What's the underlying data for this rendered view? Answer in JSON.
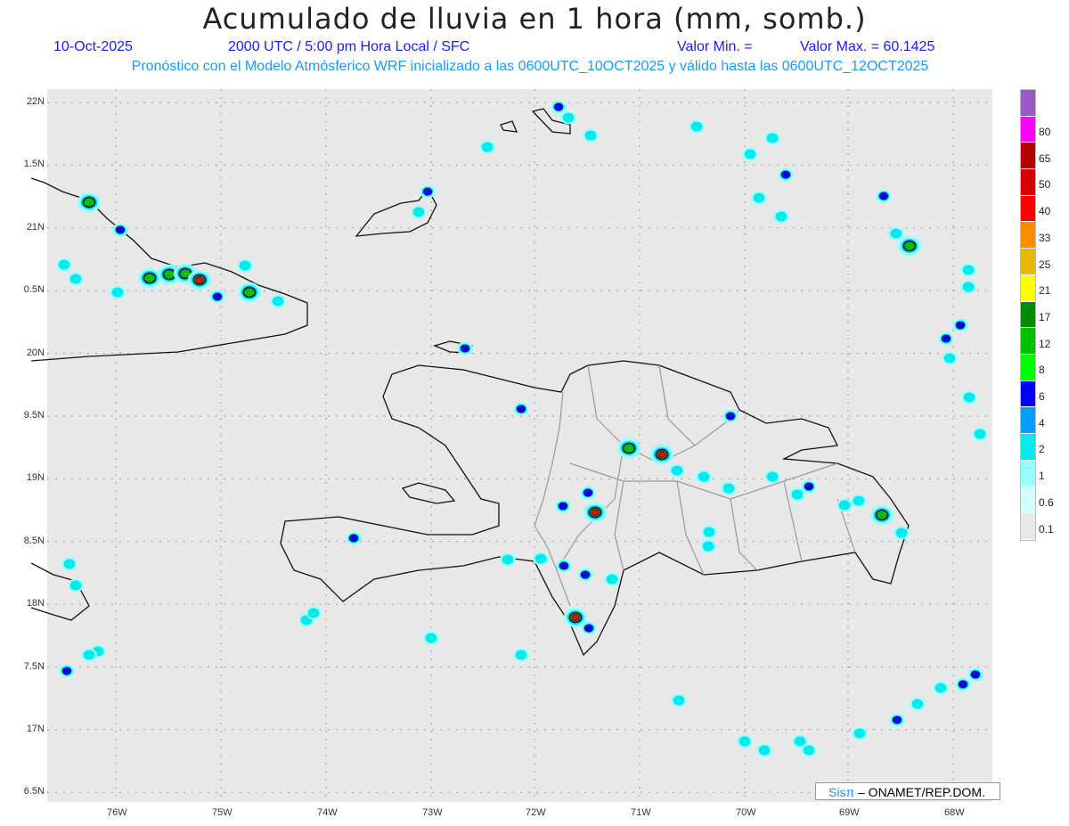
{
  "title": "Acumulado de lluvia en 1 hora (mm, somb.)",
  "date": "10-Oct-2025",
  "time": "2000 UTC / 5:00 pm Hora Local / SFC",
  "valor_min": "Valor Min. =",
  "valor_max": "Valor Max. = 60.1425",
  "model_info": "Pronóstico con el Modelo Atmósferico WRF inicializado a las 0600UTC_10OCT2025 y válido hasta las  0600UTC_12OCT2025",
  "lon_labels": [
    "76W",
    "75W",
    "74W",
    "73W",
    "72W",
    "71W",
    "70W",
    "69W",
    "68W"
  ],
  "lat_labels": [
    "22N",
    "1.5N",
    "21N",
    "0.5N",
    "20N",
    "9.5N",
    "19N",
    "8.5N",
    "18N",
    "7.5N",
    "17N",
    "6.5N"
  ],
  "colorbar": {
    "labels": [
      "80",
      "65",
      "50",
      "40",
      "33",
      "25",
      "21",
      "17",
      "12",
      "8",
      "6",
      "4",
      "2",
      "1",
      "0.6",
      "0.1"
    ],
    "colors": [
      "#9b59c8",
      "#ff00ff",
      "#b40000",
      "#d70000",
      "#ff0000",
      "#ff8c00",
      "#e6b800",
      "#ffff00",
      "#008c00",
      "#00c000",
      "#00ff00",
      "#0000ff",
      "#00a0ff",
      "#00ebeb",
      "#96ffff",
      "#d2ffff",
      "#e8e8e8"
    ]
  },
  "credit": {
    "brand": "Sisπ",
    "text": "– ONAMET/REP.DOM."
  }
}
